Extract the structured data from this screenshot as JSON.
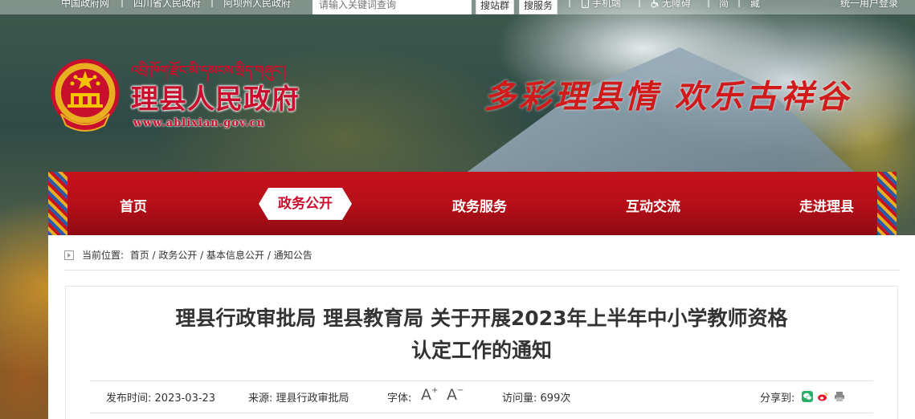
{
  "topbar": {
    "links": [
      "中国政府网",
      "四川省人民政府",
      "阿坝州人民政府"
    ],
    "search_placeholder": "请输入关键词查询",
    "search_site_label": "搜站群",
    "search_service_label": "搜服务",
    "mobile_label": "手机端",
    "accessibility_label": "无障碍",
    "simplified_label": "简",
    "tibetan_lang_label": "藏",
    "login_label": "统一用户登录"
  },
  "header": {
    "tibetan_name": "འབྲི་ཁོག་རྫོང་མི་དམངས་སྲིད་གཞུང་།",
    "site_name": "理县人民政府",
    "site_url": "www.ablixian.gov.cn",
    "slogan": "多彩理县情  欢乐古祥谷"
  },
  "nav": {
    "items": [
      {
        "label": "首页"
      },
      {
        "label": "政务公开"
      },
      {
        "label": "政务服务"
      },
      {
        "label": "互动交流"
      },
      {
        "label": "走进理县"
      }
    ],
    "active": "政务公开"
  },
  "breadcrumb": {
    "prefix": "当前位置:",
    "trail": "首页 / 政务公开 / 基本信息公开 / 通知公告"
  },
  "article": {
    "title_line1": "理县行政审批局 理县教育局 关于开展2023年上半年中小学教师资格",
    "title_line2": "认定工作的通知",
    "publish_label": "发布时间:",
    "publish_date": "2023-03-23",
    "source_label": "来源:",
    "source": "理县行政审批局",
    "font_label": "字体:",
    "views_label": "访问量:",
    "views": "699次",
    "share_label": "分享到:"
  },
  "colors": {
    "brand_red": "#c8102e",
    "nav_red": "#b30f18",
    "wechat_green": "#2aae67",
    "weibo_red": "#e6162d",
    "print_gray": "#888888"
  }
}
